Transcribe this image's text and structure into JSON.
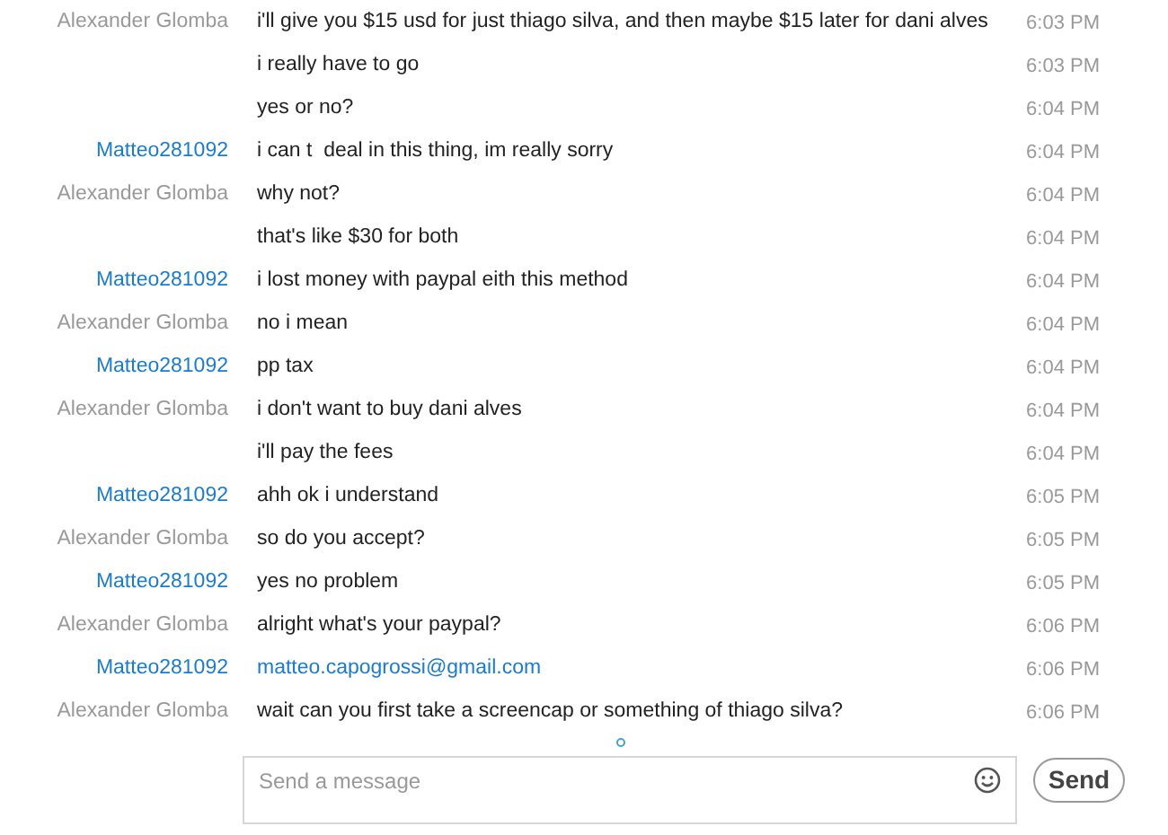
{
  "messages": [
    {
      "sender": "Alexander Glomba",
      "kind": "contact",
      "text": "i'll give you $15 usd for just thiago silva, and then maybe $15 later for dani alves",
      "time": "6:03 PM"
    },
    {
      "kind": "contact",
      "text": "i really have to go",
      "time": "6:03 PM"
    },
    {
      "kind": "contact",
      "text": "yes or no?",
      "time": "6:04 PM"
    },
    {
      "sender": "Matteo281092",
      "kind": "me",
      "text": "i can t  deal in this thing, im really sorry",
      "time": "6:04 PM"
    },
    {
      "sender": "Alexander Glomba",
      "kind": "contact",
      "text": "why not?",
      "time": "6:04 PM"
    },
    {
      "kind": "contact",
      "text": "that's like $30 for both",
      "time": "6:04 PM"
    },
    {
      "sender": "Matteo281092",
      "kind": "me",
      "text": "i lost money with paypal eith this method",
      "time": "6:04 PM"
    },
    {
      "sender": "Alexander Glomba",
      "kind": "contact",
      "text": "no i mean",
      "time": "6:04 PM"
    },
    {
      "sender": "Matteo281092",
      "kind": "me",
      "text": "pp tax",
      "time": "6:04 PM"
    },
    {
      "sender": "Alexander Glomba",
      "kind": "contact",
      "text": "i don't want to buy dani alves",
      "time": "6:04 PM"
    },
    {
      "kind": "contact",
      "text": "i'll pay the fees",
      "time": "6:04 PM"
    },
    {
      "sender": "Matteo281092",
      "kind": "me",
      "text": "ahh ok i understand",
      "time": "6:05 PM"
    },
    {
      "sender": "Alexander Glomba",
      "kind": "contact",
      "text": "so do you accept?",
      "time": "6:05 PM"
    },
    {
      "sender": "Matteo281092",
      "kind": "me",
      "text": "yes no problem",
      "time": "6:05 PM"
    },
    {
      "sender": "Alexander Glomba",
      "kind": "contact",
      "text": "alright what's your paypal?",
      "time": "6:06 PM"
    },
    {
      "sender": "Matteo281092",
      "kind": "me_link",
      "text": "matteo.capogrossi@gmail.com",
      "time": "6:06 PM"
    },
    {
      "sender": "Alexander Glomba",
      "kind": "contact",
      "text": "wait can you first take a screencap or something of thiago silva?",
      "time": "6:06 PM"
    }
  ],
  "composer": {
    "placeholder": "Send a message",
    "button": "Send"
  }
}
